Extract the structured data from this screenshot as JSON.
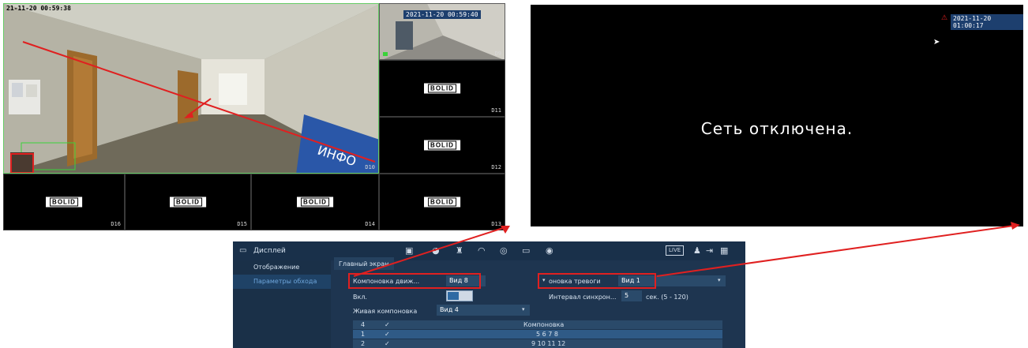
{
  "grid": {
    "main_timestamp": "21-11-20 00:59:38",
    "d9_timestamp": "2021-11-20 00:59:40",
    "sign_text": "ИНФО",
    "logo_text": "BOLID",
    "cameras": {
      "d9": "D9",
      "d10": "D10",
      "d11": "D11",
      "d12": "D12",
      "d13": "D13",
      "d14": "D14",
      "d15": "D15",
      "d16": "D16"
    }
  },
  "offline": {
    "timestamp": "2021-11-20 01:00:17",
    "message": "Сеть отключена."
  },
  "menu": {
    "title": "Дисплей",
    "live_label": "LIVE",
    "sidebar": [
      "Отображение",
      "Параметры обхода"
    ],
    "tab_main_screen": "Главный экран",
    "motion_layout_label": "Компоновка движ...",
    "motion_layout_value": "Вид 8",
    "alarm_layout_label": "оновка тревоги",
    "alarm_layout_value": "Вид 1",
    "enable_label": "Вкл.",
    "sync_interval_label": "Интервал синхрон...",
    "sync_interval_value": "5",
    "sync_interval_unit": "сек. (5 - 120)",
    "live_layout_label": "Живая компоновка",
    "live_layout_value": "Вид 4",
    "table_header": {
      "num": "4",
      "check": "✓",
      "layout": "Компоновка"
    },
    "table_rows": [
      {
        "num": "1",
        "check": "✓",
        "layout": "5 6 7 8"
      },
      {
        "num": "2",
        "check": "✓",
        "layout": "9 10 11 12"
      }
    ]
  },
  "colors": {
    "annotation_red": "#e02020",
    "menu_bg": "#1e3550",
    "menu_accent": "#2f6aa3"
  },
  "icons": [
    "monitor-icon",
    "camera-icon",
    "alarm-icon",
    "gauge-icon",
    "record-icon",
    "display-icon",
    "speaker-icon",
    "user-icon",
    "logout-icon",
    "grid-icon"
  ]
}
